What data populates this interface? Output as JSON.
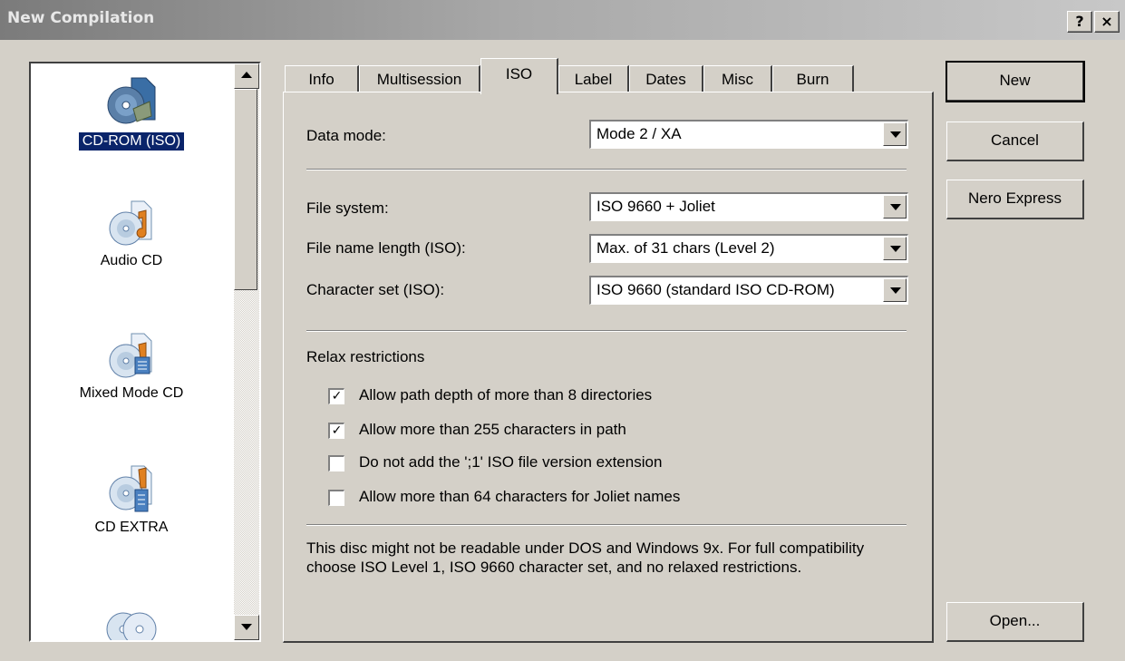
{
  "window": {
    "title": "New Compilation",
    "help_btn": "?",
    "close_btn": "×"
  },
  "compilation_types": [
    {
      "label": "CD-ROM (ISO)",
      "icon": "cd-rom-iso-icon",
      "selected": true
    },
    {
      "label": "Audio CD",
      "icon": "audio-cd-icon",
      "selected": false
    },
    {
      "label": "Mixed Mode CD",
      "icon": "mixed-mode-cd-icon",
      "selected": false
    },
    {
      "label": "CD EXTRA",
      "icon": "cd-extra-icon",
      "selected": false
    },
    {
      "label": "",
      "icon": "cd-copy-icon",
      "selected": false
    }
  ],
  "tabs": [
    {
      "label": "Info",
      "active": false
    },
    {
      "label": "Multisession",
      "active": false
    },
    {
      "label": "ISO",
      "active": true
    },
    {
      "label": "Label",
      "active": false
    },
    {
      "label": "Dates",
      "active": false
    },
    {
      "label": "Misc",
      "active": false
    },
    {
      "label": "Burn",
      "active": false
    }
  ],
  "iso": {
    "data_mode": {
      "label": "Data mode:",
      "value": "Mode 2 / XA"
    },
    "file_system": {
      "label": "File system:",
      "value": "ISO 9660 + Joliet"
    },
    "file_name_length": {
      "label": "File name length (ISO):",
      "value": "Max. of 31 chars (Level 2)"
    },
    "character_set": {
      "label": "Character set (ISO):",
      "value": "ISO 9660 (standard ISO CD-ROM)"
    },
    "relax_title": "Relax restrictions",
    "restrictions": [
      {
        "label": "Allow path depth of more than 8 directories",
        "checked": true
      },
      {
        "label": "Allow more than 255 characters in path",
        "checked": true
      },
      {
        "label": "Do not add the ';1' ISO file version extension",
        "checked": false
      },
      {
        "label": "Allow more than 64 characters for Joliet names",
        "checked": false
      }
    ],
    "info_text": "This disc might not be readable under DOS and Windows 9x. For full compatibility choose ISO Level 1, ISO 9660 character set, and no relaxed restrictions."
  },
  "buttons": {
    "new": "New",
    "cancel": "Cancel",
    "nero_express": "Nero Express",
    "open": "Open..."
  },
  "check_glyph": "✓"
}
